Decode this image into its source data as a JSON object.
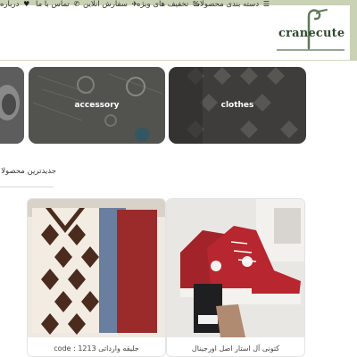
{
  "brand": {
    "logo_text": "cranecute"
  },
  "nav": {
    "items": [
      {
        "label": "دسته بندی محصولات",
        "icon": "menu-icon"
      },
      {
        "label": "تخفیف های ویژه",
        "icon": "percent-icon"
      },
      {
        "label": "سفارش آنلاین",
        "icon": "plane-icon"
      },
      {
        "label": "تماس با ما",
        "icon": "phone-icon"
      },
      {
        "label": "درباره",
        "icon": "heart-icon"
      }
    ]
  },
  "categories": [
    {
      "label": ""
    },
    {
      "label": "accessory"
    },
    {
      "label": "clothes"
    }
  ],
  "section": {
    "title": "جدیدترین محصولا"
  },
  "products": [
    {
      "name": "جلیقه وارداتی 1213 : code"
    },
    {
      "name": "کتونی آل استار اصل اورجینال"
    }
  ],
  "colors": {
    "header_frame": "#c9d2b4",
    "logo_green": "#2f4a30"
  }
}
